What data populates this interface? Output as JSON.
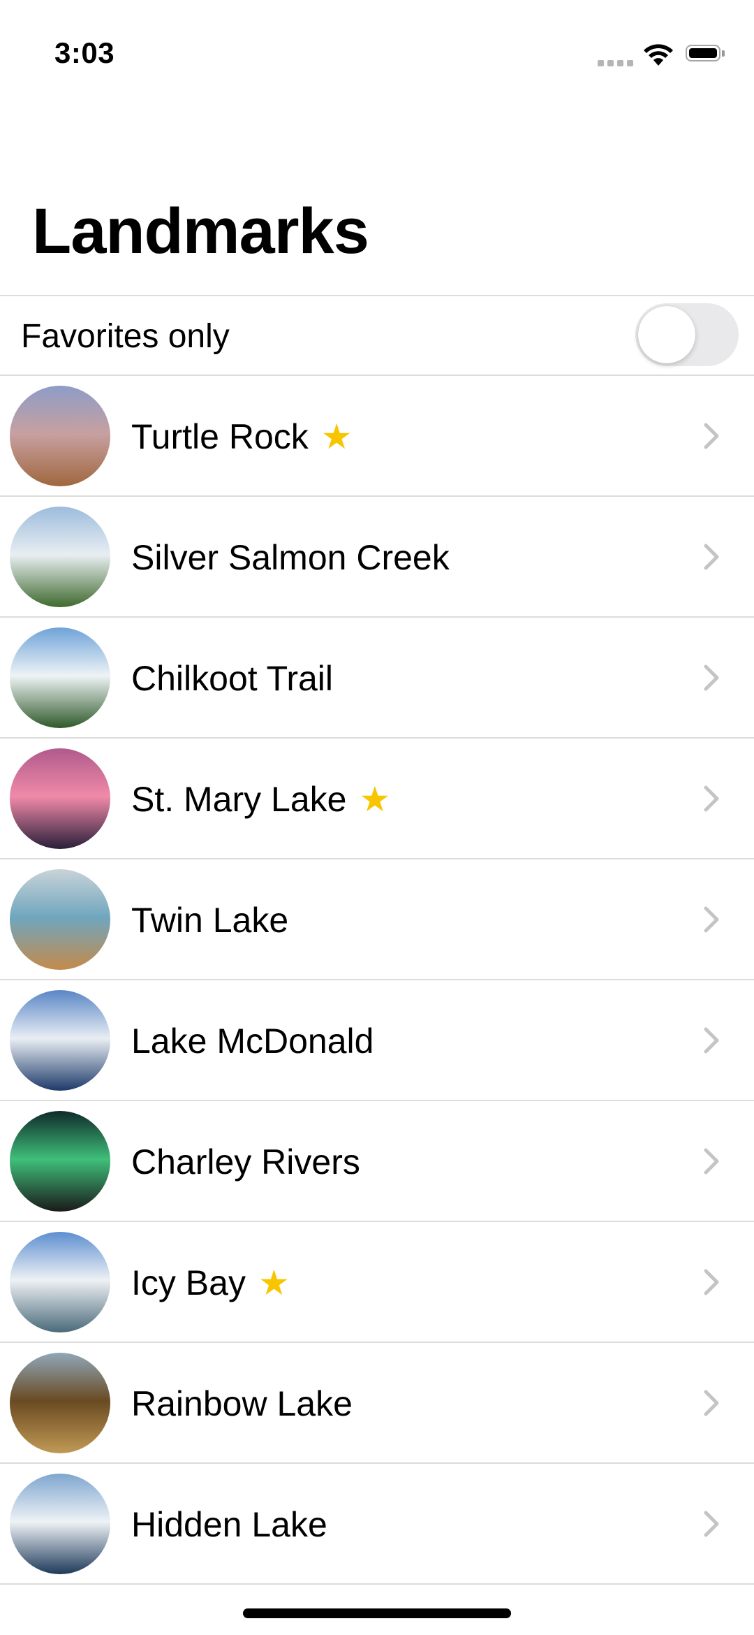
{
  "status": {
    "time": "3:03"
  },
  "header": {
    "title": "Landmarks"
  },
  "favorites_toggle": {
    "label": "Favorites only",
    "on": false
  },
  "landmarks": [
    {
      "name": "Turtle Rock",
      "favorite": true,
      "thumb_colors": [
        "#8e9cc7",
        "#c7a0a0",
        "#a0673f"
      ]
    },
    {
      "name": "Silver Salmon Creek",
      "favorite": false,
      "thumb_colors": [
        "#9dbcdc",
        "#e8eef2",
        "#3f6a2d"
      ]
    },
    {
      "name": "Chilkoot Trail",
      "favorite": false,
      "thumb_colors": [
        "#6ea3d8",
        "#eef3f6",
        "#2f5a2a"
      ]
    },
    {
      "name": "St. Mary Lake",
      "favorite": true,
      "thumb_colors": [
        "#b05a8c",
        "#f08aa8",
        "#2a1f3a"
      ]
    },
    {
      "name": "Twin Lake",
      "favorite": false,
      "thumb_colors": [
        "#c9d3d8",
        "#6fa6be",
        "#c48a4a"
      ]
    },
    {
      "name": "Lake McDonald",
      "favorite": false,
      "thumb_colors": [
        "#5a86c6",
        "#e9eef4",
        "#1e3a6a"
      ]
    },
    {
      "name": "Charley Rivers",
      "favorite": false,
      "thumb_colors": [
        "#0f2a2a",
        "#3fbf7a",
        "#1a1a1a"
      ]
    },
    {
      "name": "Icy Bay",
      "favorite": true,
      "thumb_colors": [
        "#5d8fd0",
        "#eef1f4",
        "#4a6a7a"
      ]
    },
    {
      "name": "Rainbow Lake",
      "favorite": false,
      "thumb_colors": [
        "#8fa7b8",
        "#6a4a22",
        "#c09a55"
      ]
    },
    {
      "name": "Hidden Lake",
      "favorite": false,
      "thumb_colors": [
        "#7fa6cf",
        "#eef2f6",
        "#1e3a5a"
      ]
    }
  ],
  "icons": {
    "signal": "cellular-signal-icon",
    "wifi": "wifi-icon",
    "battery": "battery-icon",
    "star": "star-icon",
    "chevron": "chevron-right-icon"
  },
  "colors": {
    "star": "#f7c600",
    "separator": "#dcdcdc",
    "chevron": "#c4c4c6",
    "toggle_off": "#e9e9eb"
  }
}
